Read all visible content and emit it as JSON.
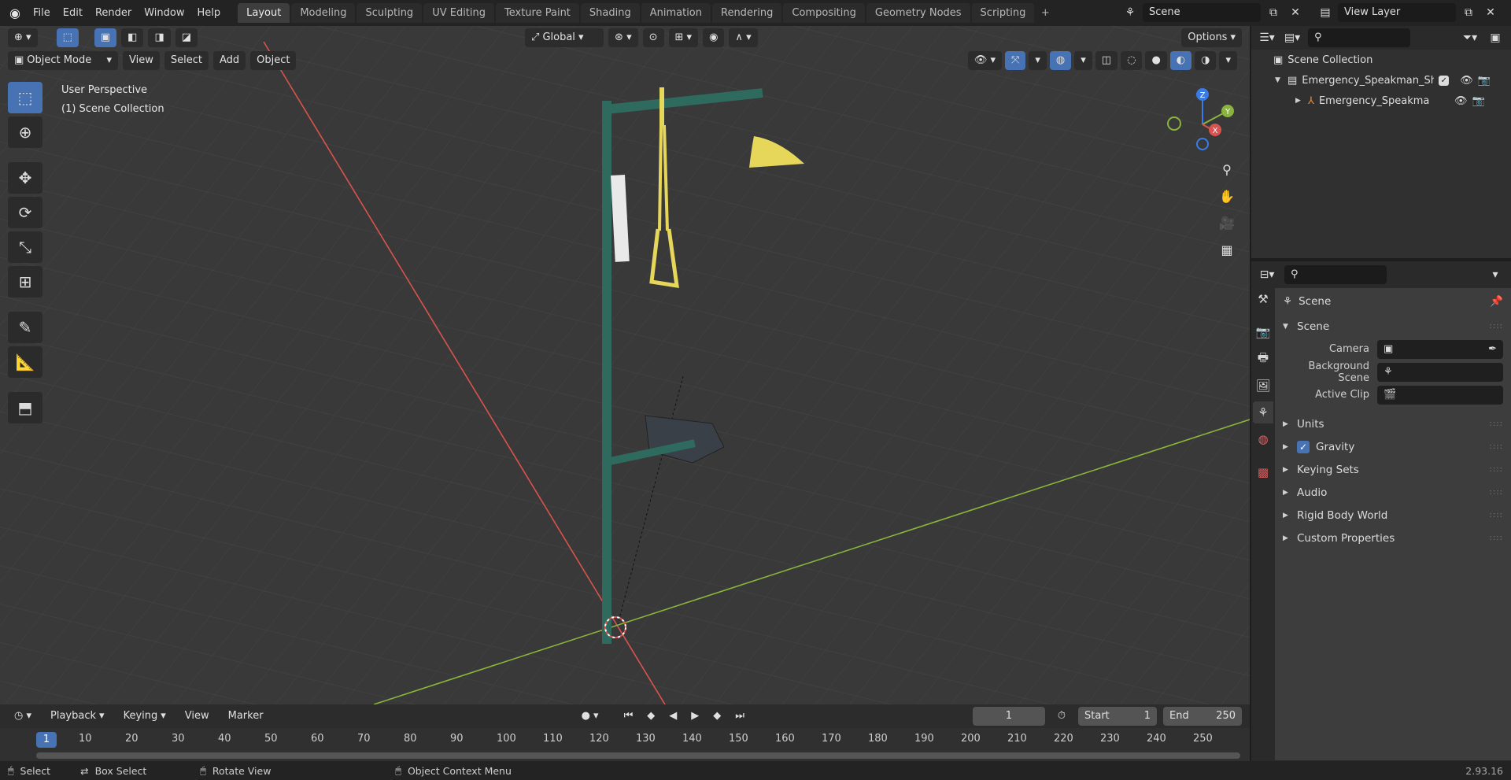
{
  "menu": {
    "file": "File",
    "edit": "Edit",
    "render": "Render",
    "window": "Window",
    "help": "Help"
  },
  "workspaces": [
    "Layout",
    "Modeling",
    "Sculpting",
    "UV Editing",
    "Texture Paint",
    "Shading",
    "Animation",
    "Rendering",
    "Compositing",
    "Geometry Nodes",
    "Scripting"
  ],
  "scene_field": "Scene",
  "view_layer_field": "View Layer",
  "viewport": {
    "transform_orientation": "Global",
    "options_label": "Options",
    "mode": "Object Mode",
    "menus": {
      "view": "View",
      "select": "Select",
      "add": "Add",
      "object": "Object"
    },
    "perspective_label": "User Perspective",
    "collection_label": "(1) Scene Collection"
  },
  "gizmo": {
    "z": "Z",
    "y": "Y",
    "x": "X"
  },
  "outliner": {
    "root": "Scene Collection",
    "collection": "Emergency_Speakman_Show",
    "object": "Emergency_Speakman_S"
  },
  "properties": {
    "header": "Scene",
    "section": "Scene",
    "camera_label": "Camera",
    "background_label": "Background Scene",
    "clip_label": "Active Clip",
    "sections": {
      "units": "Units",
      "gravity": "Gravity",
      "keying": "Keying Sets",
      "audio": "Audio",
      "rigid": "Rigid Body World",
      "custom": "Custom Properties"
    }
  },
  "timeline": {
    "menus": {
      "playback": "Playback",
      "keying": "Keying",
      "view": "View",
      "marker": "Marker"
    },
    "current_frame": "1",
    "start_label": "Start",
    "start_value": "1",
    "end_label": "End",
    "end_value": "250",
    "frame_numbers": [
      "10",
      "20",
      "30",
      "40",
      "50",
      "60",
      "70",
      "80",
      "90",
      "100",
      "110",
      "120",
      "130",
      "140",
      "150",
      "160",
      "170",
      "180",
      "190",
      "200",
      "210",
      "220",
      "230",
      "240",
      "250"
    ],
    "cursor_frame": "1"
  },
  "status": {
    "select": "Select",
    "box_select": "Box Select",
    "rotate": "Rotate View",
    "context": "Object Context Menu",
    "version": "2.93.16"
  },
  "colors": {
    "accent": "#4772b3",
    "x_axis": "#d9534f",
    "y_axis": "#8ab43c",
    "model_green": "#2e6b5e",
    "model_yellow": "#e6d65a"
  }
}
